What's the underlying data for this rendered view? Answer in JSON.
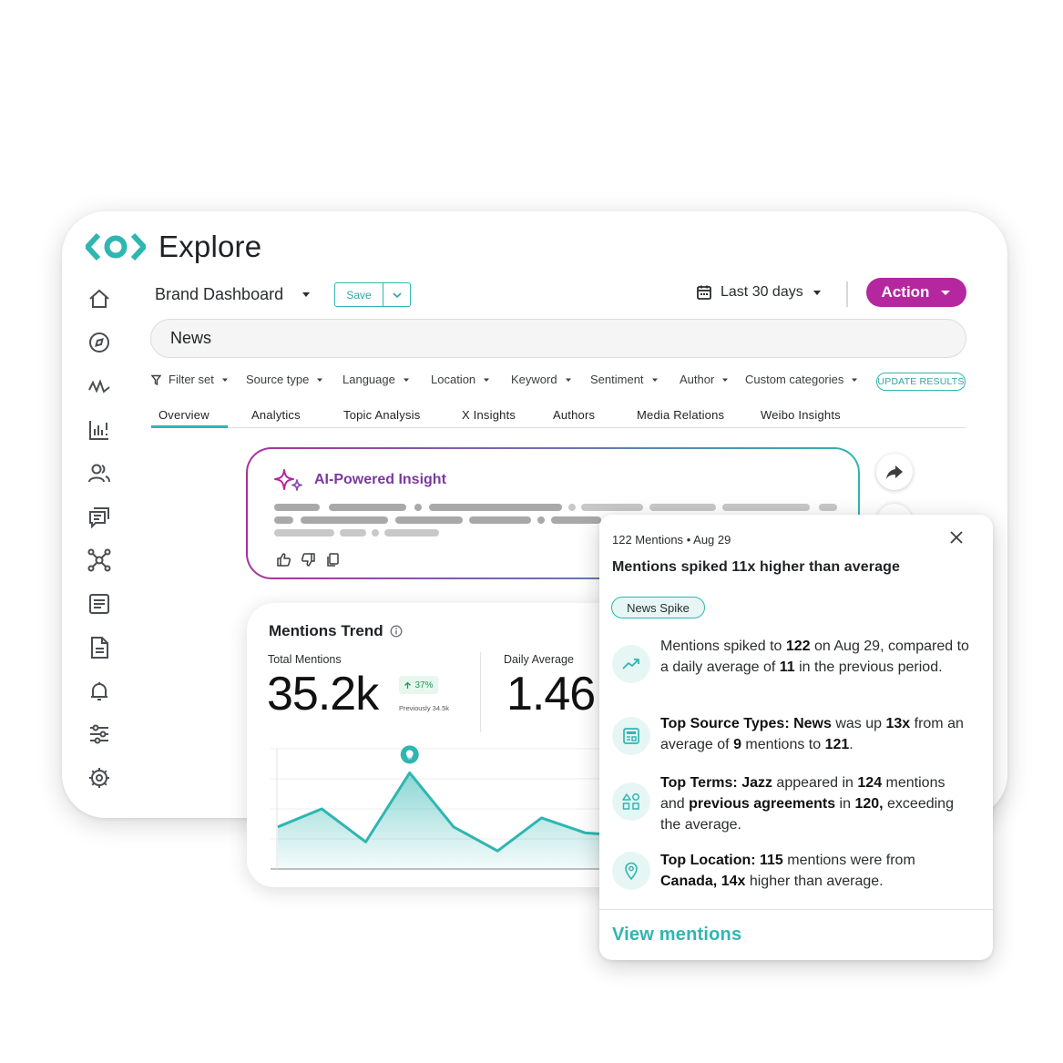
{
  "app": {
    "title": "Explore"
  },
  "toolbar": {
    "dashboard_name": "Brand Dashboard",
    "save_label": "Save",
    "date_range": "Last 30 days",
    "action_label": "Action"
  },
  "search": {
    "value": "News"
  },
  "filters": [
    "Filter set",
    "Source type",
    "Language",
    "Location",
    "Keyword",
    "Sentiment",
    "Author",
    "Custom categories"
  ],
  "update_label": "UPDATE RESULTS",
  "tabs": [
    "Overview",
    "Analytics",
    "Topic Analysis",
    "X Insights",
    "Authors",
    "Media Relations",
    "Weibo Insights"
  ],
  "active_tab": "Overview",
  "insight": {
    "title": "AI-Powered Insight"
  },
  "trend": {
    "title": "Mentions Trend",
    "total_label": "Total Mentions",
    "total_value": "35.2k",
    "change": "37%",
    "previous": "Previously 34.5k",
    "daily_label": "Daily Average",
    "daily_value": "1.46"
  },
  "chart_data": {
    "type": "area",
    "values": [
      14,
      20,
      9,
      32,
      14,
      6,
      17,
      12,
      11
    ],
    "highlight_index": 3,
    "ylim": [
      0,
      40
    ]
  },
  "popup": {
    "meta_count": "122 Mentions",
    "meta_sep": "•",
    "meta_date": "Aug 29",
    "headline": "Mentions spiked 11x higher than average",
    "chip": "News Spike",
    "r1": {
      "a": "Mentions spiked to ",
      "b": "122",
      "c": " on Aug 29, compared to a daily average of ",
      "d": "11",
      "e": " in the previous period."
    },
    "r2": {
      "a": "Top Source Types: News",
      "b": " was up ",
      "c": "13x",
      "d": " from an average of ",
      "e": "9",
      "f": " mentions to ",
      "g": "121",
      "h": "."
    },
    "r3": {
      "a": "Top Terms: Jazz",
      "b": " appeared in ",
      "c": "124",
      "d": " mentions and ",
      "e": "previous agreements",
      "f": " in ",
      "g": "120,",
      "h": " exceeding the average."
    },
    "r4": {
      "a": "Top Location: 115",
      "b": " mentions were from ",
      "c": "Canada, 14x",
      "d": " higher than average."
    },
    "view_label": "View mentions"
  },
  "colors": {
    "accent": "#2fb6b1",
    "action": "#b5279e",
    "insight": "#7b3aa0",
    "text": "#1f2124"
  },
  "icons": {
    "sidebar": [
      "home-icon",
      "compass-icon",
      "trend-icon",
      "bar-chart-icon",
      "users-icon",
      "chat-icon",
      "network-icon",
      "document-list-icon",
      "report-icon",
      "bell-icon",
      "sliders-icon",
      "settings-icon"
    ]
  }
}
